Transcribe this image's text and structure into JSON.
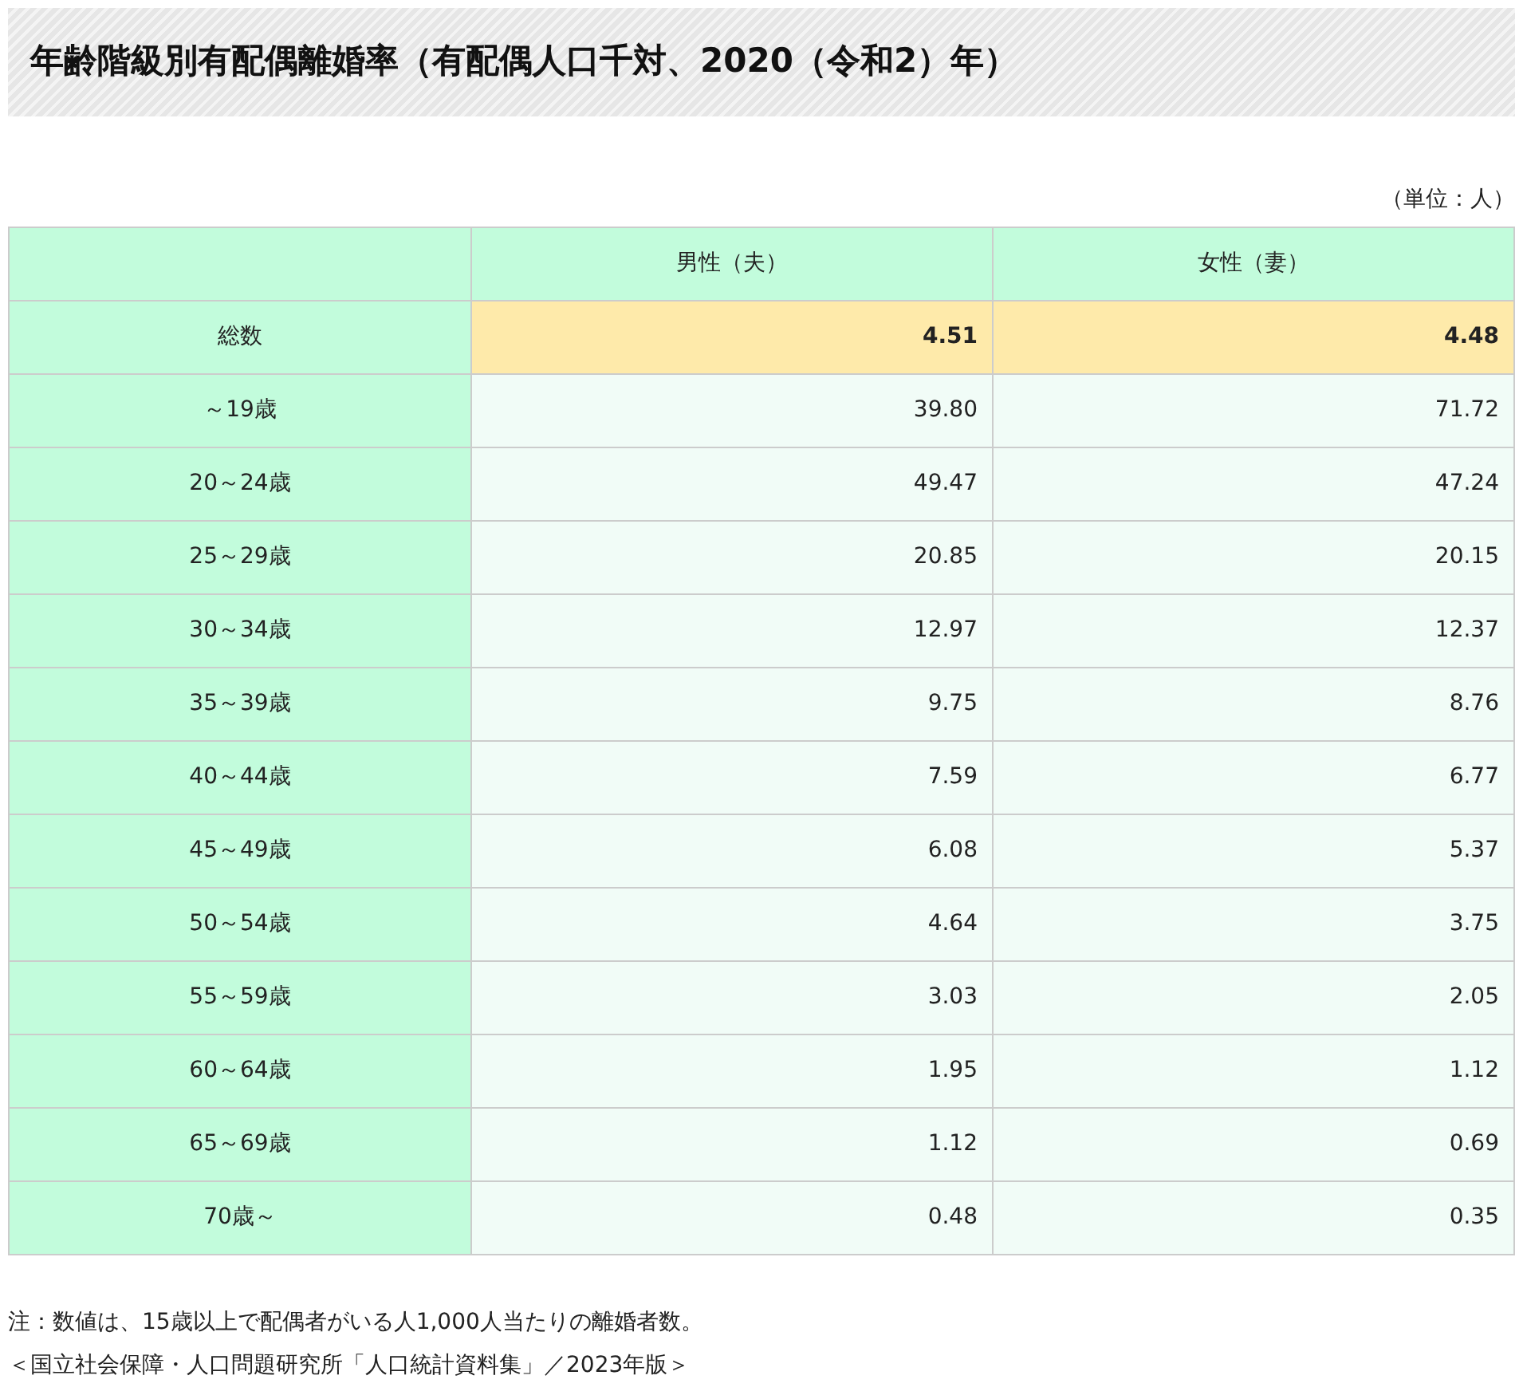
{
  "title": "年齢階級別有配偶離婚率（有配偶人口千対、2020（令和2）年）",
  "unit": "（単位：人）",
  "table": {
    "columns": [
      "男性（夫）",
      "女性（妻）"
    ],
    "rows": [
      {
        "kind": "total",
        "label": "総数",
        "values": [
          "4.51",
          "4.48"
        ]
      },
      {
        "kind": "normal",
        "label": "～19歳",
        "values": [
          "39.80",
          "71.72"
        ]
      },
      {
        "kind": "normal",
        "label": "20～24歳",
        "values": [
          "49.47",
          "47.24"
        ]
      },
      {
        "kind": "normal",
        "label": "25～29歳",
        "values": [
          "20.85",
          "20.15"
        ]
      },
      {
        "kind": "normal",
        "label": "30～34歳",
        "values": [
          "12.97",
          "12.37"
        ]
      },
      {
        "kind": "normal",
        "label": "35～39歳",
        "values": [
          "9.75",
          "8.76"
        ]
      },
      {
        "kind": "normal",
        "label": "40～44歳",
        "values": [
          "7.59",
          "6.77"
        ]
      },
      {
        "kind": "normal",
        "label": "45～49歳",
        "values": [
          "6.08",
          "5.37"
        ]
      },
      {
        "kind": "normal",
        "label": "50～54歳",
        "values": [
          "4.64",
          "3.75"
        ]
      },
      {
        "kind": "normal",
        "label": "55～59歳",
        "values": [
          "3.03",
          "2.05"
        ]
      },
      {
        "kind": "normal",
        "label": "60～64歳",
        "values": [
          "1.95",
          "1.12"
        ]
      },
      {
        "kind": "normal",
        "label": "65～69歳",
        "values": [
          "1.12",
          "0.69"
        ]
      },
      {
        "kind": "normal",
        "label": "70歳～",
        "values": [
          "0.48",
          "0.35"
        ]
      }
    ]
  },
  "notes": [
    "注：数値は、15歳以上で配偶者がいる人1,000人当たりの離婚者数。",
    "＜国立社会保障・人口問題研究所「人口統計資料集」／2023年版＞"
  ]
}
